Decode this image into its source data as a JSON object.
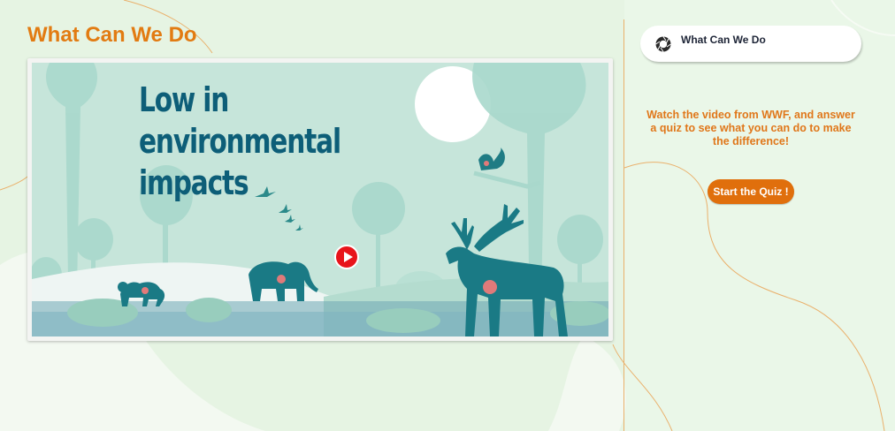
{
  "page": {
    "title": "What Can We Do"
  },
  "video": {
    "headline": "Low in environmental\nimpacts"
  },
  "sidebar": {
    "tab_label": "What Can We Do",
    "tab_icon": "aperture-icon",
    "description": "Watch the video from WWF, and answer a quiz to see what you can do to make the difference!",
    "quiz_button_label": "Start the Quiz !"
  },
  "colors": {
    "accent": "#e06f0c",
    "title": "#e27b12",
    "headline": "#0d5e78",
    "play": "#e8141b",
    "background": "#e6f4e3"
  }
}
